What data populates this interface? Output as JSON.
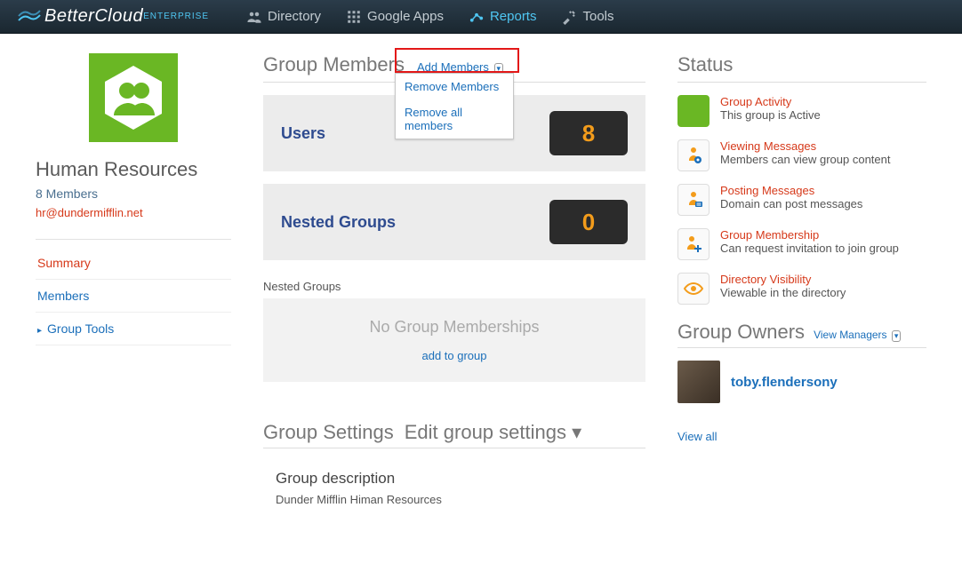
{
  "brand": {
    "name": "BetterCloud",
    "tier": "ENTERPRISE"
  },
  "nav": {
    "directory": "Directory",
    "googleapps": "Google Apps",
    "reports": "Reports",
    "tools": "Tools"
  },
  "group": {
    "name": "Human Resources",
    "members_line": "8 Members",
    "email": "hr@dundermifflin.net"
  },
  "sidenav": {
    "summary": "Summary",
    "members": "Members",
    "tools": "Group Tools"
  },
  "members_section": {
    "title": "Group Members",
    "add": "Add Members",
    "dropdown": {
      "remove": "Remove Members",
      "remove_all": "Remove all members"
    },
    "users_label": "Users",
    "users_count": "8",
    "nested_label_card": "Nested Groups",
    "nested_count": "0",
    "nested_heading": "Nested Groups",
    "nested_empty": "No Group Memberships",
    "nested_add": "add to group"
  },
  "settings_section": {
    "title": "Group Settings",
    "edit": "Edit group settings",
    "desc_heading": "Group description",
    "desc_text": "Dunder Mifflin Himan Resources"
  },
  "status_section": {
    "title": "Status",
    "items": [
      {
        "t": "Group Activity",
        "s": "This group is Active"
      },
      {
        "t": "Viewing Messages",
        "s": "Members can view group content"
      },
      {
        "t": "Posting Messages",
        "s": "Domain can post messages"
      },
      {
        "t": "Group Membership",
        "s": "Can request invitation to join group"
      },
      {
        "t": "Directory Visibility",
        "s": "Viewable in the directory"
      }
    ]
  },
  "owners_section": {
    "title": "Group Owners",
    "managers": "View Managers",
    "owner_name": "toby.flendersony",
    "view_all": "View all"
  }
}
